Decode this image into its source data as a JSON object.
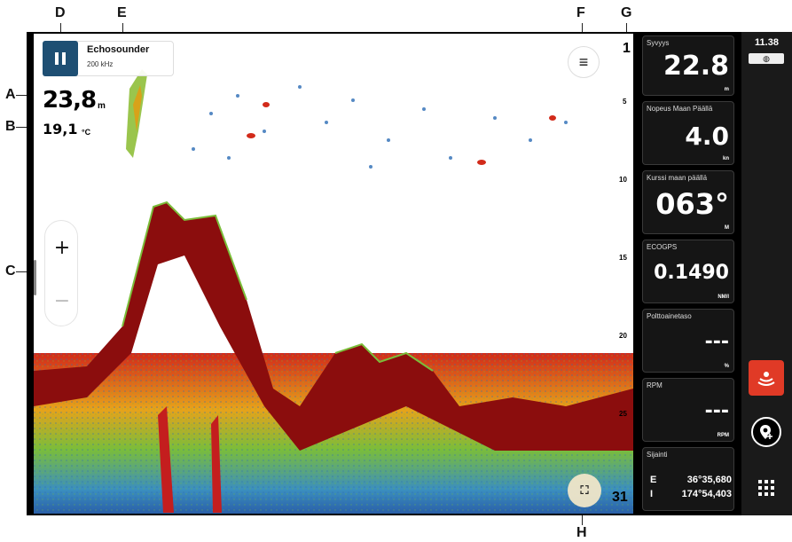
{
  "callouts": [
    "A",
    "B",
    "C",
    "D",
    "E",
    "F",
    "G",
    "H"
  ],
  "source": {
    "name": "Echosounder",
    "frequency": "200 kHz"
  },
  "readouts": {
    "depth": "23,8",
    "depth_unit": "m",
    "temperature": "19,1",
    "temperature_unit": "°C"
  },
  "zoom": {
    "in_label": "+",
    "out_label": "−"
  },
  "depth_scale": {
    "top": "1",
    "ticks": [
      "5",
      "10",
      "15",
      "20",
      "25"
    ],
    "bottom": "31"
  },
  "data_tiles": [
    {
      "title": "Syvyys",
      "value": "22.8",
      "unit": "m"
    },
    {
      "title": "Nopeus Maan Päällä",
      "value": "4.0",
      "unit": "kn"
    },
    {
      "title": "Kurssi maan päällä",
      "value": "063°",
      "unit": "M"
    },
    {
      "title": "ECOGPS",
      "value": "0.1490",
      "unit": "NM/l"
    },
    {
      "title": "Polttoainetaso",
      "value": "---",
      "unit": "%"
    },
    {
      "title": "RPM",
      "value": "---",
      "unit": "RPM"
    }
  ],
  "position_tile": {
    "title": "Sijainti",
    "east_label": "E",
    "east_value": "36°35,680",
    "north_label": "I",
    "north_value": "174°54,403"
  },
  "sidebar": {
    "time": "11.38",
    "gps_icon": "globe-icon"
  },
  "colors": {
    "bottom_echo": "#8b0d0d",
    "pause_button": "#1e4f73",
    "sonar_app_active": "#e03a26",
    "panel_bg": "#000000"
  }
}
